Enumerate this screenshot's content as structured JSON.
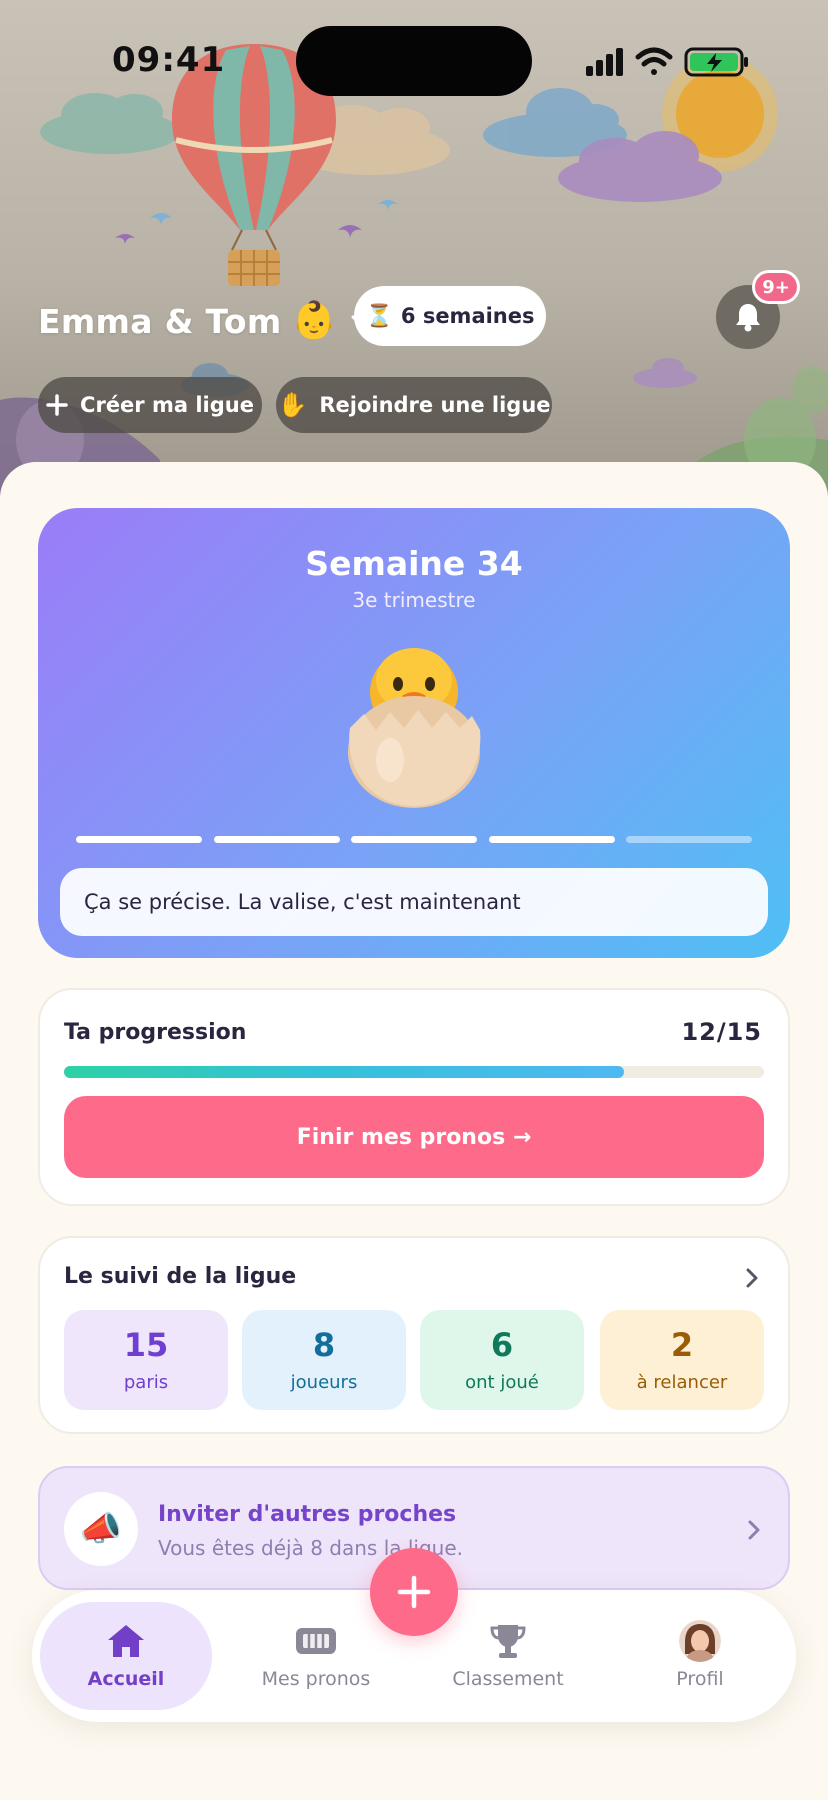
{
  "status_bar": {
    "time": "09:41"
  },
  "header": {
    "couple_name": "Emma & Tom",
    "couple_emoji": "👶",
    "weeks_pill": {
      "icon": "⏳",
      "label": "6 semaines"
    },
    "notifications_badge": "9+",
    "create_league_label": "Créer ma ligue",
    "join_league_icon": "✋",
    "join_league_label": "Rejoindre une ligue"
  },
  "week_card": {
    "title": "Semaine 34",
    "subtitle": "3e trimestre",
    "illustration": "hatching-chick",
    "segments_filled": 4,
    "segments_total": 5,
    "tip": "Ça se précise. La valise, c'est maintenant"
  },
  "progress": {
    "label": "Ta progression",
    "count": "12/15",
    "fraction": 0.8,
    "cta_label": "Finir mes pronos →"
  },
  "league": {
    "title": "Le suivi de la ligue",
    "stats": [
      {
        "value": "15",
        "label": "paris"
      },
      {
        "value": "8",
        "label": "joueurs"
      },
      {
        "value": "6",
        "label": "ont joué"
      },
      {
        "value": "2",
        "label": "à relancer"
      }
    ]
  },
  "invite": {
    "icon": "📣",
    "title": "Inviter d'autres proches",
    "subtitle": "Vous êtes déjà 8 dans la ligue."
  },
  "tabbar": {
    "items": [
      {
        "label": "Accueil",
        "icon": "home-icon",
        "active": true
      },
      {
        "label": "Mes pronos",
        "icon": "ticket-icon",
        "active": false
      },
      {
        "label": "Classement",
        "icon": "trophy-icon",
        "active": false
      },
      {
        "label": "Profil",
        "icon": "avatar",
        "active": false
      }
    ]
  },
  "colors": {
    "accent_pink": "#fe6a8a",
    "accent_purple": "#7240c8",
    "card_gradient_start": "#9b7cf8",
    "card_gradient_end": "#4fbff5"
  }
}
